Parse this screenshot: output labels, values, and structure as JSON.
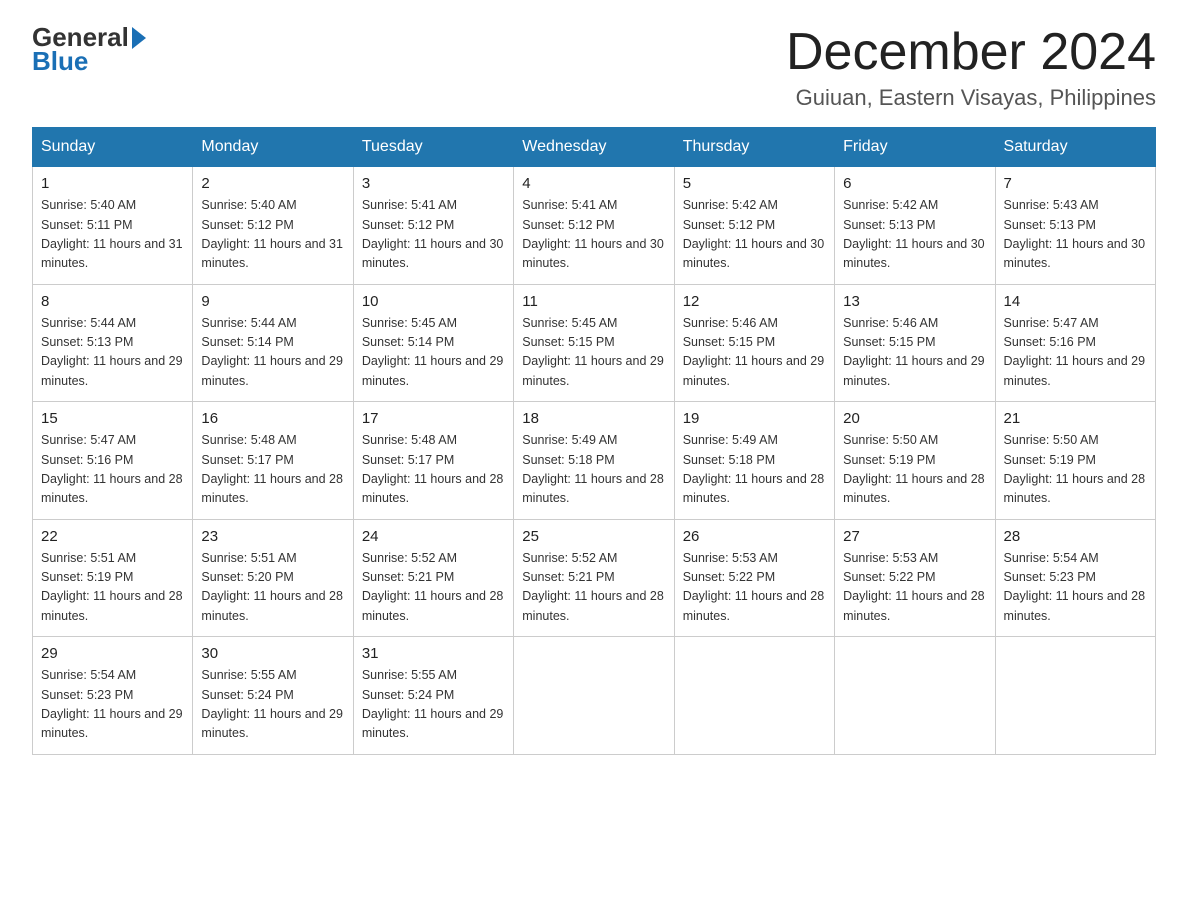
{
  "logo": {
    "general": "General",
    "arrow": "▶",
    "blue": "Blue"
  },
  "title": "December 2024",
  "subtitle": "Guiuan, Eastern Visayas, Philippines",
  "headers": [
    "Sunday",
    "Monday",
    "Tuesday",
    "Wednesday",
    "Thursday",
    "Friday",
    "Saturday"
  ],
  "weeks": [
    [
      {
        "day": "1",
        "sunrise": "5:40 AM",
        "sunset": "5:11 PM",
        "daylight": "11 hours and 31 minutes."
      },
      {
        "day": "2",
        "sunrise": "5:40 AM",
        "sunset": "5:12 PM",
        "daylight": "11 hours and 31 minutes."
      },
      {
        "day": "3",
        "sunrise": "5:41 AM",
        "sunset": "5:12 PM",
        "daylight": "11 hours and 30 minutes."
      },
      {
        "day": "4",
        "sunrise": "5:41 AM",
        "sunset": "5:12 PM",
        "daylight": "11 hours and 30 minutes."
      },
      {
        "day": "5",
        "sunrise": "5:42 AM",
        "sunset": "5:12 PM",
        "daylight": "11 hours and 30 minutes."
      },
      {
        "day": "6",
        "sunrise": "5:42 AM",
        "sunset": "5:13 PM",
        "daylight": "11 hours and 30 minutes."
      },
      {
        "day": "7",
        "sunrise": "5:43 AM",
        "sunset": "5:13 PM",
        "daylight": "11 hours and 30 minutes."
      }
    ],
    [
      {
        "day": "8",
        "sunrise": "5:44 AM",
        "sunset": "5:13 PM",
        "daylight": "11 hours and 29 minutes."
      },
      {
        "day": "9",
        "sunrise": "5:44 AM",
        "sunset": "5:14 PM",
        "daylight": "11 hours and 29 minutes."
      },
      {
        "day": "10",
        "sunrise": "5:45 AM",
        "sunset": "5:14 PM",
        "daylight": "11 hours and 29 minutes."
      },
      {
        "day": "11",
        "sunrise": "5:45 AM",
        "sunset": "5:15 PM",
        "daylight": "11 hours and 29 minutes."
      },
      {
        "day": "12",
        "sunrise": "5:46 AM",
        "sunset": "5:15 PM",
        "daylight": "11 hours and 29 minutes."
      },
      {
        "day": "13",
        "sunrise": "5:46 AM",
        "sunset": "5:15 PM",
        "daylight": "11 hours and 29 minutes."
      },
      {
        "day": "14",
        "sunrise": "5:47 AM",
        "sunset": "5:16 PM",
        "daylight": "11 hours and 29 minutes."
      }
    ],
    [
      {
        "day": "15",
        "sunrise": "5:47 AM",
        "sunset": "5:16 PM",
        "daylight": "11 hours and 28 minutes."
      },
      {
        "day": "16",
        "sunrise": "5:48 AM",
        "sunset": "5:17 PM",
        "daylight": "11 hours and 28 minutes."
      },
      {
        "day": "17",
        "sunrise": "5:48 AM",
        "sunset": "5:17 PM",
        "daylight": "11 hours and 28 minutes."
      },
      {
        "day": "18",
        "sunrise": "5:49 AM",
        "sunset": "5:18 PM",
        "daylight": "11 hours and 28 minutes."
      },
      {
        "day": "19",
        "sunrise": "5:49 AM",
        "sunset": "5:18 PM",
        "daylight": "11 hours and 28 minutes."
      },
      {
        "day": "20",
        "sunrise": "5:50 AM",
        "sunset": "5:19 PM",
        "daylight": "11 hours and 28 minutes."
      },
      {
        "day": "21",
        "sunrise": "5:50 AM",
        "sunset": "5:19 PM",
        "daylight": "11 hours and 28 minutes."
      }
    ],
    [
      {
        "day": "22",
        "sunrise": "5:51 AM",
        "sunset": "5:19 PM",
        "daylight": "11 hours and 28 minutes."
      },
      {
        "day": "23",
        "sunrise": "5:51 AM",
        "sunset": "5:20 PM",
        "daylight": "11 hours and 28 minutes."
      },
      {
        "day": "24",
        "sunrise": "5:52 AM",
        "sunset": "5:21 PM",
        "daylight": "11 hours and 28 minutes."
      },
      {
        "day": "25",
        "sunrise": "5:52 AM",
        "sunset": "5:21 PM",
        "daylight": "11 hours and 28 minutes."
      },
      {
        "day": "26",
        "sunrise": "5:53 AM",
        "sunset": "5:22 PM",
        "daylight": "11 hours and 28 minutes."
      },
      {
        "day": "27",
        "sunrise": "5:53 AM",
        "sunset": "5:22 PM",
        "daylight": "11 hours and 28 minutes."
      },
      {
        "day": "28",
        "sunrise": "5:54 AM",
        "sunset": "5:23 PM",
        "daylight": "11 hours and 28 minutes."
      }
    ],
    [
      {
        "day": "29",
        "sunrise": "5:54 AM",
        "sunset": "5:23 PM",
        "daylight": "11 hours and 29 minutes."
      },
      {
        "day": "30",
        "sunrise": "5:55 AM",
        "sunset": "5:24 PM",
        "daylight": "11 hours and 29 minutes."
      },
      {
        "day": "31",
        "sunrise": "5:55 AM",
        "sunset": "5:24 PM",
        "daylight": "11 hours and 29 minutes."
      },
      null,
      null,
      null,
      null
    ]
  ]
}
